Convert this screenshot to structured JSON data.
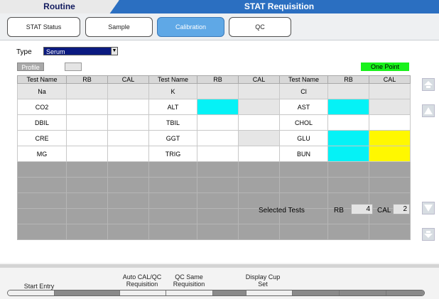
{
  "header": {
    "routine_tab": "Routine",
    "active_title": "STAT Requisition"
  },
  "subtabs": [
    {
      "label": "STAT Status",
      "active": false
    },
    {
      "label": "Sample",
      "active": false
    },
    {
      "label": "Calibration",
      "active": true
    },
    {
      "label": "QC",
      "active": false
    }
  ],
  "form": {
    "type_label": "Type",
    "type_value": "Serum",
    "profile_label": "Profile",
    "mode_badge": "One Point"
  },
  "grid": {
    "headers": [
      "Test Name",
      "RB",
      "CAL",
      "Test Name",
      "RB",
      "CAL",
      "Test Name",
      "RB",
      "CAL"
    ],
    "rows": [
      [
        "Na",
        "",
        "",
        "K",
        "",
        "",
        "Cl",
        "",
        ""
      ],
      [
        "CO2",
        "",
        "",
        "ALT",
        "",
        "",
        "AST",
        "",
        ""
      ],
      [
        "DBIL",
        "",
        "",
        "TBIL",
        "",
        "",
        "CHOL",
        "",
        ""
      ],
      [
        "CRE",
        "",
        "",
        "GGT",
        "",
        "",
        "GLU",
        "",
        ""
      ],
      [
        "MG",
        "",
        "",
        "TRIG",
        "",
        "",
        "BUN",
        "",
        ""
      ],
      [
        "",
        "",
        "",
        "",
        "",
        "",
        "",
        "",
        ""
      ],
      [
        "",
        "",
        "",
        "",
        "",
        "",
        "",
        "",
        ""
      ],
      [
        "",
        "",
        "",
        "",
        "",
        "",
        "",
        "",
        ""
      ],
      [
        "",
        "",
        "",
        "",
        "",
        "",
        "",
        "",
        ""
      ],
      [
        "",
        "",
        "",
        "",
        "",
        "",
        "",
        "",
        ""
      ]
    ],
    "cell_states": [
      [
        "light",
        "light",
        "light",
        "light",
        "light",
        "light",
        "light",
        "light",
        "light"
      ],
      [
        "white",
        "white",
        "white",
        "white",
        "cyan",
        "light",
        "white",
        "cyan",
        "light"
      ],
      [
        "white",
        "white",
        "white",
        "white",
        "white",
        "white",
        "white",
        "white",
        "white"
      ],
      [
        "white",
        "white",
        "white",
        "white",
        "white",
        "light",
        "white",
        "cyan",
        "yellow"
      ],
      [
        "white",
        "white",
        "white",
        "white",
        "white",
        "white",
        "white",
        "cyan",
        "yellow"
      ],
      [
        "dark",
        "dark",
        "dark",
        "dark",
        "dark",
        "dark",
        "dark",
        "dark",
        "dark"
      ],
      [
        "dark",
        "dark",
        "dark",
        "dark",
        "dark",
        "dark",
        "dark",
        "dark",
        "dark"
      ],
      [
        "dark",
        "dark",
        "dark",
        "dark",
        "dark",
        "dark",
        "dark",
        "dark",
        "dark"
      ],
      [
        "dark",
        "dark",
        "dark",
        "dark",
        "dark",
        "dark",
        "dark",
        "dark",
        "dark"
      ],
      [
        "dark",
        "dark",
        "dark",
        "dark",
        "dark",
        "dark",
        "dark",
        "dark",
        "dark"
      ]
    ]
  },
  "selected": {
    "label": "Selected Tests",
    "rb_label": "RB",
    "rb_value": "4",
    "cal_label": "CAL",
    "cal_value": "2"
  },
  "function_keys": {
    "start_entry": "Start Entry",
    "auto_cal_qc": "Auto CAL/QC Requisition",
    "qc_same": "QC Same Requisition",
    "display_cup": "Display Cup Set"
  },
  "colors": {
    "header_blue": "#2b6fc1",
    "active_tab": "#5fa8e6",
    "cyan_cell": "#05f2f6",
    "yellow_cell": "#fff800",
    "badge_green": "#19f21b"
  }
}
